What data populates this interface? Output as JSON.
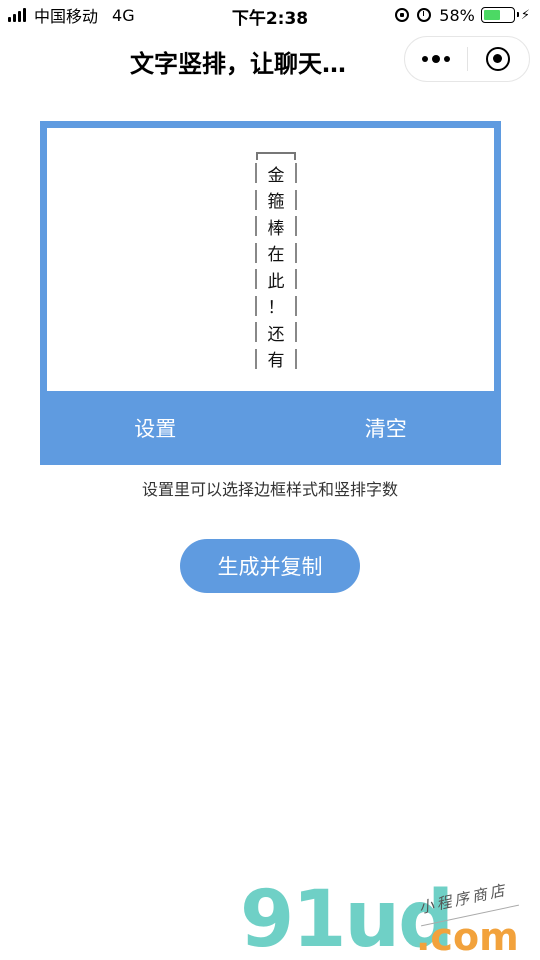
{
  "status_bar": {
    "carrier": "中国移动",
    "network": "4G",
    "time": "下午2:38",
    "battery_percent": "58%",
    "battery_level": 0.58
  },
  "nav": {
    "title": "文字竖排，让聊天…"
  },
  "editor": {
    "vertical_chars": [
      "金",
      "箍",
      "棒",
      "在",
      "此",
      "！",
      "还",
      "有"
    ]
  },
  "card_actions": {
    "settings_label": "设置",
    "clear_label": "清空"
  },
  "hint": "设置里可以选择边框样式和竖排字数",
  "primary_button": "生成并复制",
  "watermark": {
    "logo": "91ud",
    "suffix": ".com",
    "tagline": "小程序商店"
  },
  "colors": {
    "accent": "#5f9be0",
    "battery": "#4cd964",
    "watermark_teal": "#6fd0c6",
    "watermark_orange": "#f2a23c"
  }
}
